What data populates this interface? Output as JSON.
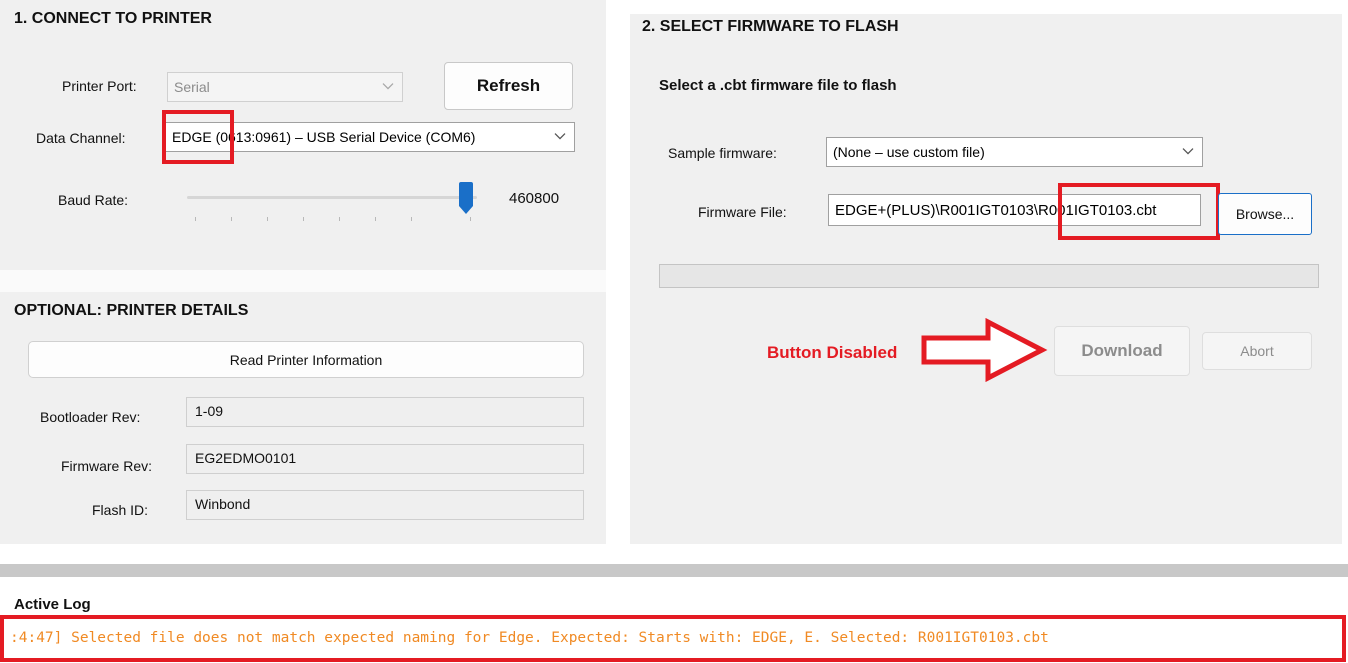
{
  "connect": {
    "title": "1. CONNECT TO PRINTER",
    "printer_port_label": "Printer Port:",
    "printer_port_value": "Serial",
    "refresh_label": "Refresh",
    "data_channel_label": "Data Channel:",
    "data_channel_value": "EDGE (0613:0961) – USB Serial Device (COM6)",
    "baud_rate_label": "Baud Rate:",
    "baud_rate_value": "460800"
  },
  "details": {
    "title": "OPTIONAL: PRINTER DETAILS",
    "read_button_label": "Read Printer Information",
    "bootloader_label": "Bootloader Rev:",
    "bootloader_value": "1-09",
    "firmware_label": "Firmware Rev:",
    "firmware_value": "EG2EDMO0101",
    "flash_label": "Flash ID:",
    "flash_value": "Winbond"
  },
  "firmware": {
    "title": "2. SELECT FIRMWARE TO FLASH",
    "subtitle": "Select a .cbt firmware file to flash",
    "sample_label": "Sample firmware:",
    "sample_value": "(None – use custom file)",
    "file_label": "Firmware File:",
    "file_value": "EDGE+(PLUS)\\R001IGT0103\\R001IGT0103.cbt",
    "browse_label": "Browse...",
    "progress": 0,
    "download_label": "Download",
    "abort_label": "Abort"
  },
  "annotation": {
    "text": "Button Disabled",
    "color": "#e41b23"
  },
  "log": {
    "title": "Active Log",
    "line": ":4:47] Selected file does not match expected naming for Edge. Expected: Starts with: EDGE, E. Selected: R001IGT0103.cbt",
    "line_color": "#f08a24"
  },
  "icons": {
    "dropdown": "chevron-down-icon",
    "slider": "slider-thumb-icon",
    "arrow": "arrow-right-icon"
  }
}
